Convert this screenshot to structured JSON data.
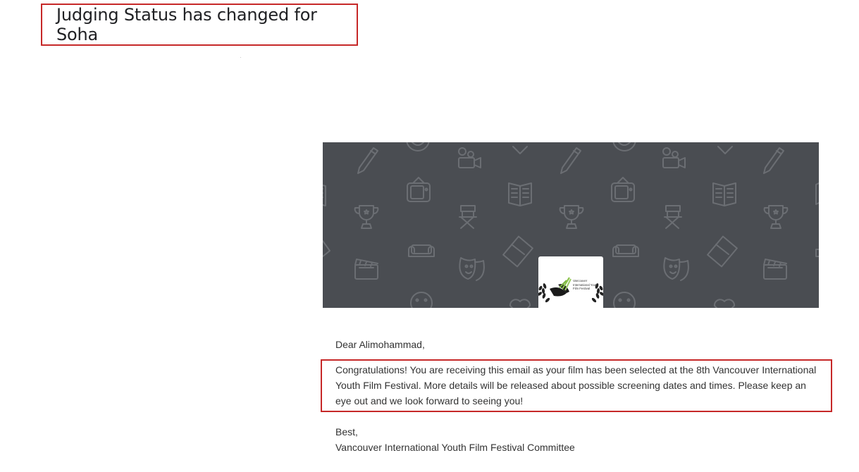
{
  "email": {
    "subject": "Judging Status has changed for Soha",
    "banner": {
      "background_color": "#4a4d52",
      "logo_text": "Vancouver International Youth Film Festival"
    },
    "greeting": "Dear Alimohammad,",
    "message": "Congratulations! You are receiving this email as your film has been selected at the 8th Vancouver International Youth Film Festival. More details will be released about possible screening dates and times. Please keep an eye out and we look forward to seeing you!",
    "signoff": "Best,",
    "signature": "Vancouver International Youth Film Festival Committee"
  },
  "colors": {
    "highlight_border": "#c62828",
    "text": "#333333"
  }
}
